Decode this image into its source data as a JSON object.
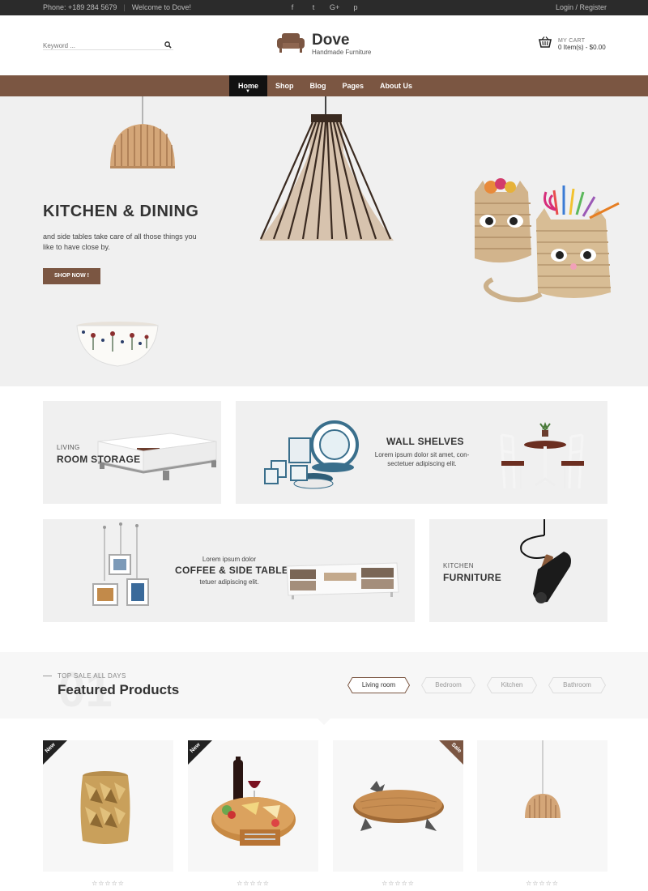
{
  "topbar": {
    "phone": "Phone: +189 284 5679",
    "welcome": "Welcome to Dove!",
    "social": [
      "facebook-icon",
      "twitter-icon",
      "google-plus-icon",
      "pinterest-icon"
    ],
    "social_glyphs": [
      "f",
      "t",
      "G+",
      "p"
    ],
    "login": "Login / Register"
  },
  "header": {
    "search_placeholder": "Keyword ...",
    "logo_name": "Dove",
    "logo_tagline": "Handmade Furniture",
    "cart_label": "MY CART",
    "cart_summary": "0 Item(s) - $0.00"
  },
  "nav": {
    "items": [
      "Home",
      "Shop",
      "Blog",
      "Pages",
      "About Us"
    ]
  },
  "hero": {
    "title": "KITCHEN & DINING",
    "text": "and side tables take care of all those things you like to have close by.",
    "button": "SHOP NOW !"
  },
  "banners": {
    "living": {
      "small": "LIVING",
      "big": "ROOM STORAGE"
    },
    "wall": {
      "big": "WALL SHELVES",
      "desc": "Lorem ipsum dolor sit amet, con- sectetuer adipiscing elit."
    },
    "coffee": {
      "top": "Lorem ipsum dolor",
      "big": "COFFEE & SIDE TABLES",
      "bottom": "tetuer adipiscing elit."
    },
    "kitchen": {
      "small": "KITCHEN",
      "big": "FURNITURE"
    }
  },
  "featured": {
    "bg_number": "01",
    "subtitle": "TOP SALE ALL DAYS",
    "title": "Featured Products",
    "tabs": [
      "Living room",
      "Bedroom",
      "Kitchen",
      "Bathroom"
    ],
    "active_tab": "Living room"
  },
  "products": [
    {
      "badge": "New",
      "image": "gold-stool",
      "rating": "☆☆☆☆☆"
    },
    {
      "badge": "New",
      "image": "cheese-board",
      "rating": "☆☆☆☆☆"
    },
    {
      "badge": "Sale",
      "image": "wooden-tray",
      "rating": "☆☆☆☆☆"
    },
    {
      "badge": "",
      "image": "pendant-lamp",
      "rating": "☆☆☆☆☆"
    }
  ],
  "colors": {
    "brand": "#7b5642",
    "topbar": "#2b2b2b",
    "panel": "#f0f0f0"
  }
}
